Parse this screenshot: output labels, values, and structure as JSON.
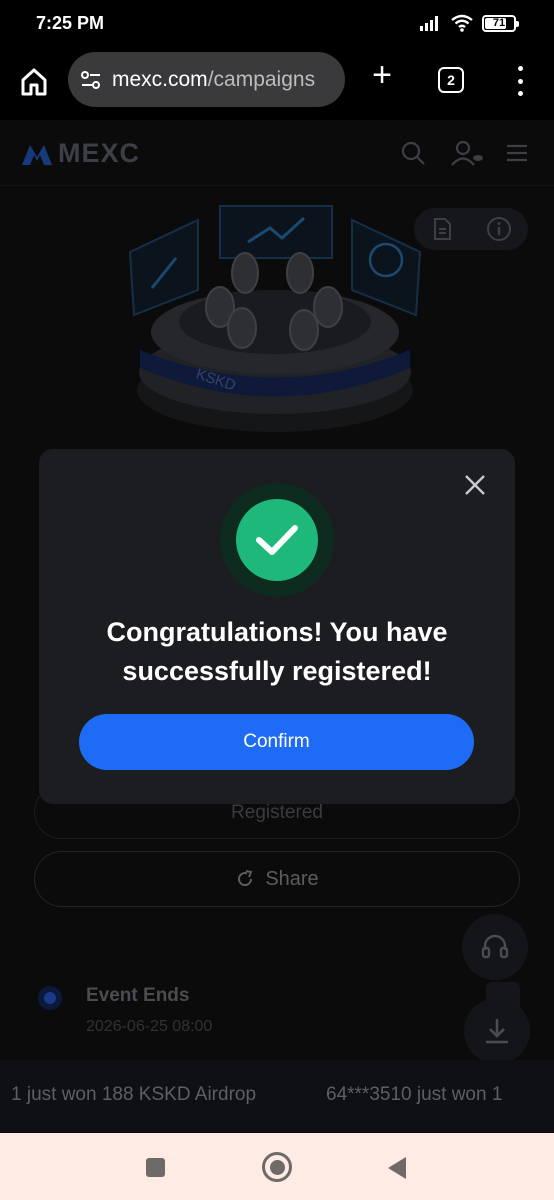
{
  "status_bar": {
    "time": "7:25 PM",
    "battery": "71"
  },
  "browser": {
    "url_domain": "mexc.com",
    "url_path": "/campaigns",
    "tab_count": "2"
  },
  "page": {
    "logo_text": "MEXC",
    "registered_label": "Registered",
    "share_label": "Share",
    "event_title": "Event Ends",
    "event_date": "2026-06-25 08:00",
    "hero_badge_text": "KSKD",
    "ticker": [
      "1 just won 188 KSKD Airdrop",
      "64***3510 just won 1"
    ]
  },
  "modal": {
    "title": "Congratulations! You have successfully registered!",
    "confirm_label": "Confirm"
  },
  "colors": {
    "accent": "#1e6cf5",
    "success": "#1db87a",
    "modal_bg": "#1c1d21"
  }
}
